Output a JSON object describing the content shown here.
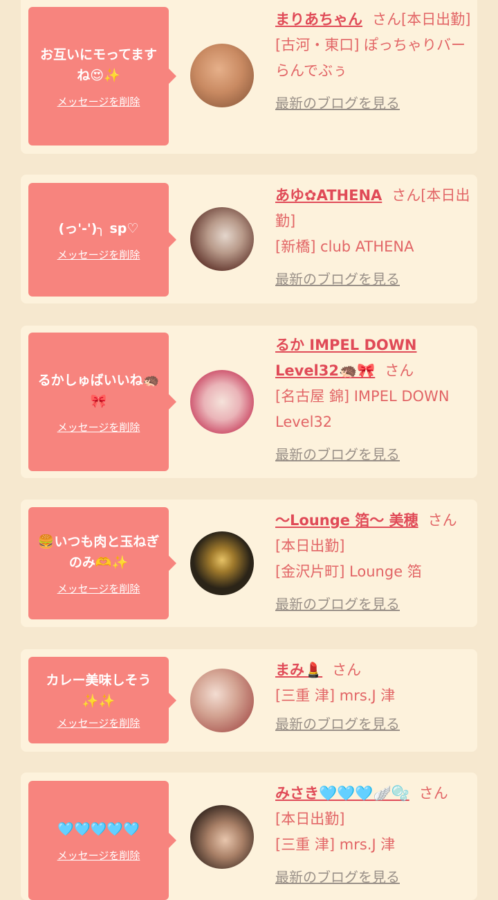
{
  "delete_label": "メッセージを削除",
  "blog_label": "最新のブログを見る",
  "san_label": "さん",
  "cards": [
    {
      "message": "お互いにモってますね😍✨",
      "name": "まりあちゃん",
      "detail1": "[本日出勤]",
      "detail2": "[古河・東口] ぽっちゃりバー らんでぶぅ",
      "avatar_colors": [
        "#d99b76",
        "#8c5a3c"
      ]
    },
    {
      "message": "(っ'-')╮ sp♡",
      "name": "あゆ✿ATHENA",
      "detail1": "[本日出勤]",
      "detail2": "[新橋] club ATHENA",
      "avatar_colors": [
        "#6b3a2e",
        "#cfd8d2"
      ]
    },
    {
      "message": "るかしゅばいいね🦔🎀",
      "name": "るか IMPEL DOWN Level32🦔🎀",
      "detail1": "",
      "detail2": "[名古屋 錦] IMPEL DOWN Level32",
      "avatar_colors": [
        "#f0c8c0",
        "#d14a6a"
      ]
    },
    {
      "message": "🍔いつも肉と玉ねぎのみ🫶✨",
      "name": "〜Lounge 箔〜 美穂",
      "detail1": "[本日出勤]",
      "detail2": "[金沢片町] Lounge 箔",
      "avatar_colors": [
        "#2b2418",
        "#c9a552"
      ]
    },
    {
      "message": "カレー美味しそう✨✨",
      "name": "まみ💄",
      "detail1": "",
      "detail2": "[三重 津] mrs.J 津",
      "avatar_colors": [
        "#e8c8b8",
        "#b0605a"
      ]
    },
    {
      "message": "🩵🩵🩵🩵🩵",
      "name": "みさき🩵🩵🩵🪽🫧",
      "detail1": "[本日出勤]",
      "detail2": "[三重 津] mrs.J 津",
      "avatar_colors": [
        "#3a2a22",
        "#d8b49a"
      ]
    }
  ]
}
